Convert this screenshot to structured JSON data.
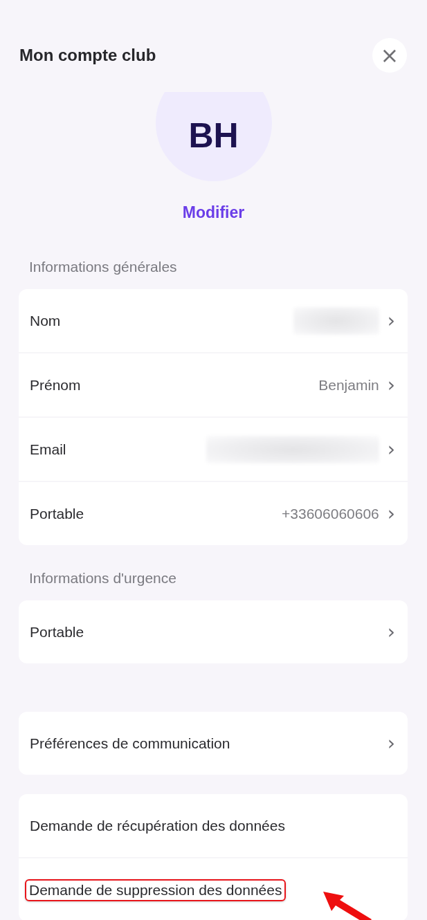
{
  "header": {
    "title": "Mon compte club",
    "close_button": "×"
  },
  "profile": {
    "initials": "BH",
    "edit_link": "Modifier"
  },
  "sections": [
    {
      "title": "Informations générales",
      "rows": [
        {
          "label": "Nom",
          "kind": "blurred",
          "chevron": "›"
        },
        {
          "label": "Prénom",
          "kind": "text",
          "value": "Benjamin",
          "chevron": "›"
        },
        {
          "label": "Email",
          "kind": "blurred",
          "chevron": "›"
        },
        {
          "label": "Portable",
          "kind": "text",
          "value": "+33606060606",
          "chevron": "›"
        }
      ]
    },
    {
      "title": "Informations d'urgence",
      "rows": [
        {
          "label": "Portable",
          "kind": "plain",
          "chevron": "›"
        }
      ]
    },
    {
      "rows": [
        {
          "label": "Préférences de communication",
          "kind": "plain",
          "chevron": "›"
        }
      ]
    },
    {
      "rows": [
        {
          "label": "Demande de récupération des données",
          "kind": "action",
          "highlighted": false
        },
        {
          "label": "Demande de suppression des données",
          "kind": "action",
          "highlighted": true
        }
      ]
    }
  ]
}
